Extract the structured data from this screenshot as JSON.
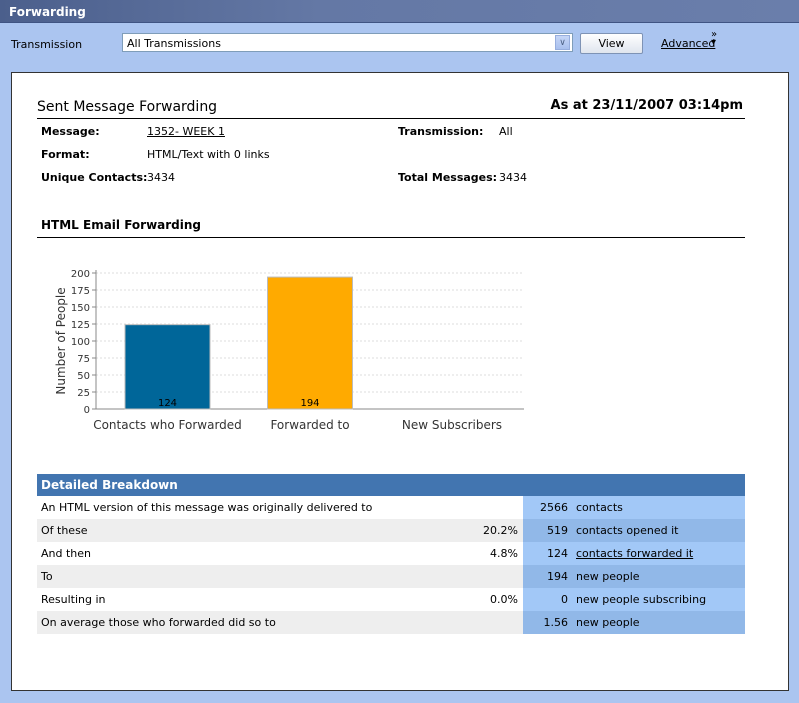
{
  "window": {
    "title": "Forwarding"
  },
  "toolbar": {
    "transmission_label": "Transmission",
    "transmission_value": "All Transmissions",
    "view_label": "View",
    "advanced_label": "Advanced",
    "advanced_icon": "double-chevron-icon"
  },
  "report": {
    "title": "Sent Message Forwarding",
    "as_at": "As at 23/11/2007 03:14pm",
    "fields": {
      "message_label": "Message:",
      "message_value": "1352- WEEK 1",
      "transmission_label": "Transmission:",
      "transmission_value": "All",
      "format_label": "Format:",
      "format_value": "HTML/Text with 0 links",
      "unique_label": "Unique Contacts:",
      "unique_value": "3434",
      "total_label": "Total Messages:",
      "total_value": "3434"
    },
    "section_title": "HTML Email Forwarding"
  },
  "chart_data": {
    "type": "bar",
    "categories": [
      "Contacts who Forwarded",
      "Forwarded to",
      "New Subscribers"
    ],
    "values": [
      124,
      194,
      0
    ],
    "data_labels": [
      "124",
      "194",
      ""
    ],
    "colors": [
      "#006699",
      "#ffaa00",
      "#999999"
    ],
    "ylabel": "Number of People",
    "ylim": [
      0,
      200
    ],
    "yticks": [
      0,
      25,
      50,
      75,
      100,
      125,
      150,
      175,
      200
    ],
    "grid": true
  },
  "breakdown": {
    "title": "Detailed Breakdown",
    "rows": [
      {
        "desc": "An HTML version of this message was originally delivered to",
        "pct": "",
        "num": "2566",
        "unit": "contacts",
        "link": false
      },
      {
        "desc": "Of these",
        "pct": "20.2%",
        "num": "519",
        "unit": "contacts opened it",
        "link": false
      },
      {
        "desc": "And then",
        "pct": "4.8%",
        "num": "124",
        "unit": "contacts forwarded it",
        "link": true
      },
      {
        "desc": "To",
        "pct": "",
        "num": "194",
        "unit": "new people",
        "link": false
      },
      {
        "desc": "Resulting in",
        "pct": "0.0%",
        "num": "0",
        "unit": "new people subscribing",
        "link": false
      },
      {
        "desc": "On average those who forwarded did so to",
        "pct": "",
        "num": "1.56",
        "unit": "new people",
        "link": false
      }
    ]
  }
}
